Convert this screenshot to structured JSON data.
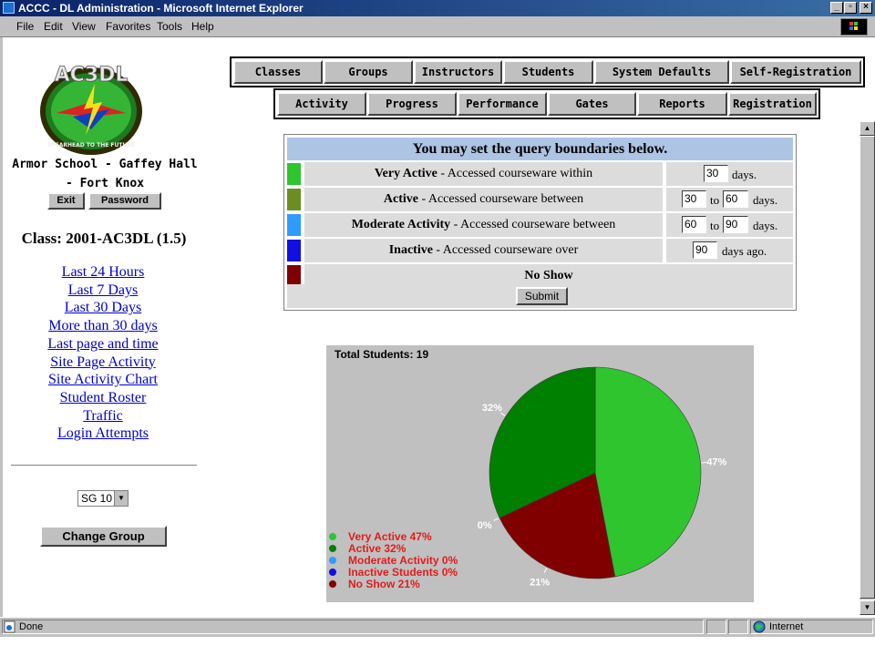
{
  "window": {
    "title": "ACCC - DL Administration - Microsoft Internet Explorer"
  },
  "menu": [
    "File",
    "Edit",
    "View",
    "Favorites",
    "Tools",
    "Help"
  ],
  "sidebar": {
    "logo_text": "AC3DL",
    "logo_motto": "SPEARHEAD TO THE FUTURE",
    "school_line1": "Armor School - Gaffey Hall",
    "school_line2": "- Fort Knox",
    "exit_label": "Exit",
    "password_label": "Password",
    "class_label": "Class: 2001-AC3DL (1.5)",
    "links": [
      "Last 24 Hours",
      "Last 7 Days",
      "Last 30 Days",
      "More than 30 days",
      "Last page and time",
      "Site Page Activity",
      "Site Activity Chart",
      "Student Roster",
      "Traffic",
      "Login Attempts"
    ],
    "group_value": "SG 10",
    "change_group_label": "Change Group"
  },
  "nav": {
    "row1": [
      "Classes",
      "Groups",
      "Instructors",
      "Students",
      "System Defaults",
      "Self-Registration"
    ],
    "row2": [
      "Activity",
      "Progress",
      "Performance",
      "Gates",
      "Reports",
      "Registration"
    ]
  },
  "query": {
    "header": "You may set the query boundaries below.",
    "rows": [
      {
        "name": "Very Active",
        "desc": " - Accessed courseware within",
        "color": "#2ec52e",
        "v1": "30",
        "unit": "days."
      },
      {
        "name": "Active",
        "desc": " - Accessed courseware between",
        "color": "#6b8e23",
        "v1": "30",
        "to": "to",
        "v2": "60",
        "unit": "days."
      },
      {
        "name": "Moderate Activity",
        "desc": " - Accessed courseware between",
        "color": "#2f9bff",
        "v1": "60",
        "to": "to",
        "v2": "90",
        "unit": "days."
      },
      {
        "name": "Inactive",
        "desc": " - Accessed courseware over",
        "color": "#1010e0",
        "v1": "90",
        "unit": "days ago."
      }
    ],
    "noshow": {
      "label": "No Show",
      "color": "#800000"
    },
    "submit_label": "Submit"
  },
  "chart_data": {
    "type": "pie",
    "title": "Total Students: 19",
    "slices": [
      {
        "name": "Very Active",
        "value": 47,
        "color": "#2ec52e"
      },
      {
        "name": "Active",
        "value": 32,
        "color": "#008000"
      },
      {
        "name": "Moderate Activity",
        "value": 0,
        "color": "#2f9bff"
      },
      {
        "name": "Inactive Students",
        "value": 0,
        "color": "#1010e0"
      },
      {
        "name": "No Show",
        "value": 21,
        "color": "#800000"
      }
    ],
    "legend": [
      "Very Active 47%",
      "Active 32%",
      "Moderate Activity 0%",
      "Inactive Students 0%",
      "No Show 21%"
    ],
    "labels": [
      "47%",
      "32%",
      "0%",
      "21%"
    ]
  },
  "status": {
    "left": "Done",
    "zone": "Internet"
  }
}
